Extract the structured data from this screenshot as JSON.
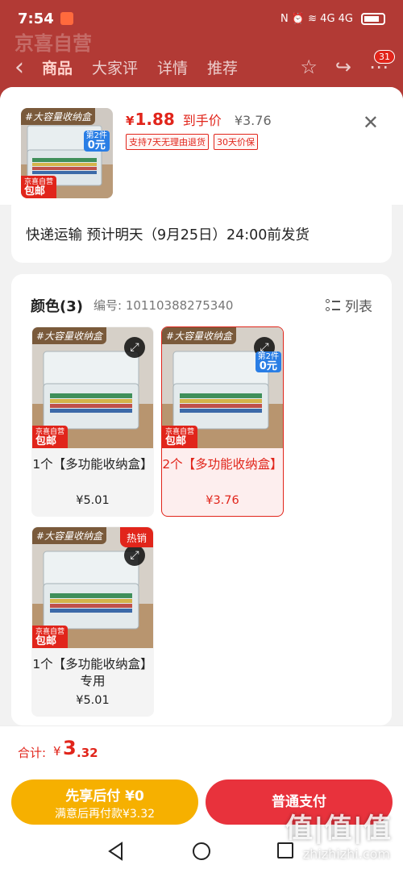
{
  "status_bar": {
    "time": "7:54",
    "icons": "N ⏰ ≋ 4G 4G"
  },
  "under_nav": {
    "brand_ghost": "京喜自营",
    "tabs": [
      "商品",
      "大家评",
      "详情",
      "推荐"
    ],
    "cart_count": "31"
  },
  "product": {
    "currency": "¥",
    "price": "1.88",
    "price_tag": "到手价",
    "original_price": "¥3.76",
    "services": [
      "支持7天无理由退货",
      "30天价保"
    ],
    "close_icon": "close-icon"
  },
  "shipping": {
    "text": "快递运输 预计明天（9月25日）24:00前发货"
  },
  "color_section": {
    "title": "颜色(3)",
    "code": "编号: 10110388275340",
    "list_label": "列表",
    "options": [
      {
        "label": "1个【多功能收纳盒】",
        "price": "¥5.01",
        "banner": "#大容量收纳盒",
        "badge_brand": "京喜自营",
        "badge_pkg": "包邮"
      },
      {
        "label": "2个【多功能收纳盒】",
        "price": "¥3.76",
        "banner": "#大容量收纳盒",
        "badge_brand": "京喜自营",
        "badge_pkg": "包邮",
        "promo_top": "第2件",
        "promo_value": "0元"
      },
      {
        "label": "1个【多功能收纳盒】专用",
        "price": "¥5.01",
        "banner": "#大容量收纳盒",
        "badge_brand": "京喜自营",
        "badge_pkg": "包邮",
        "hot": "热销"
      }
    ],
    "thumb_banner": "#大容量收纳盒",
    "thumb_promo_top": "第2件",
    "thumb_promo_value": "0元",
    "thumb_brand": "京喜自营",
    "thumb_pkg": "包邮"
  },
  "total": {
    "label": "合计:",
    "currency": "¥",
    "int": "3",
    "dec": ".32"
  },
  "buttons": {
    "pay_later_line1": "先享后付 ¥0",
    "pay_later_line2": "满意后再付款¥3.32",
    "pay": "普通支付"
  },
  "watermark": {
    "main": "值|值|值",
    "sub": "zhizhizhi.com"
  }
}
